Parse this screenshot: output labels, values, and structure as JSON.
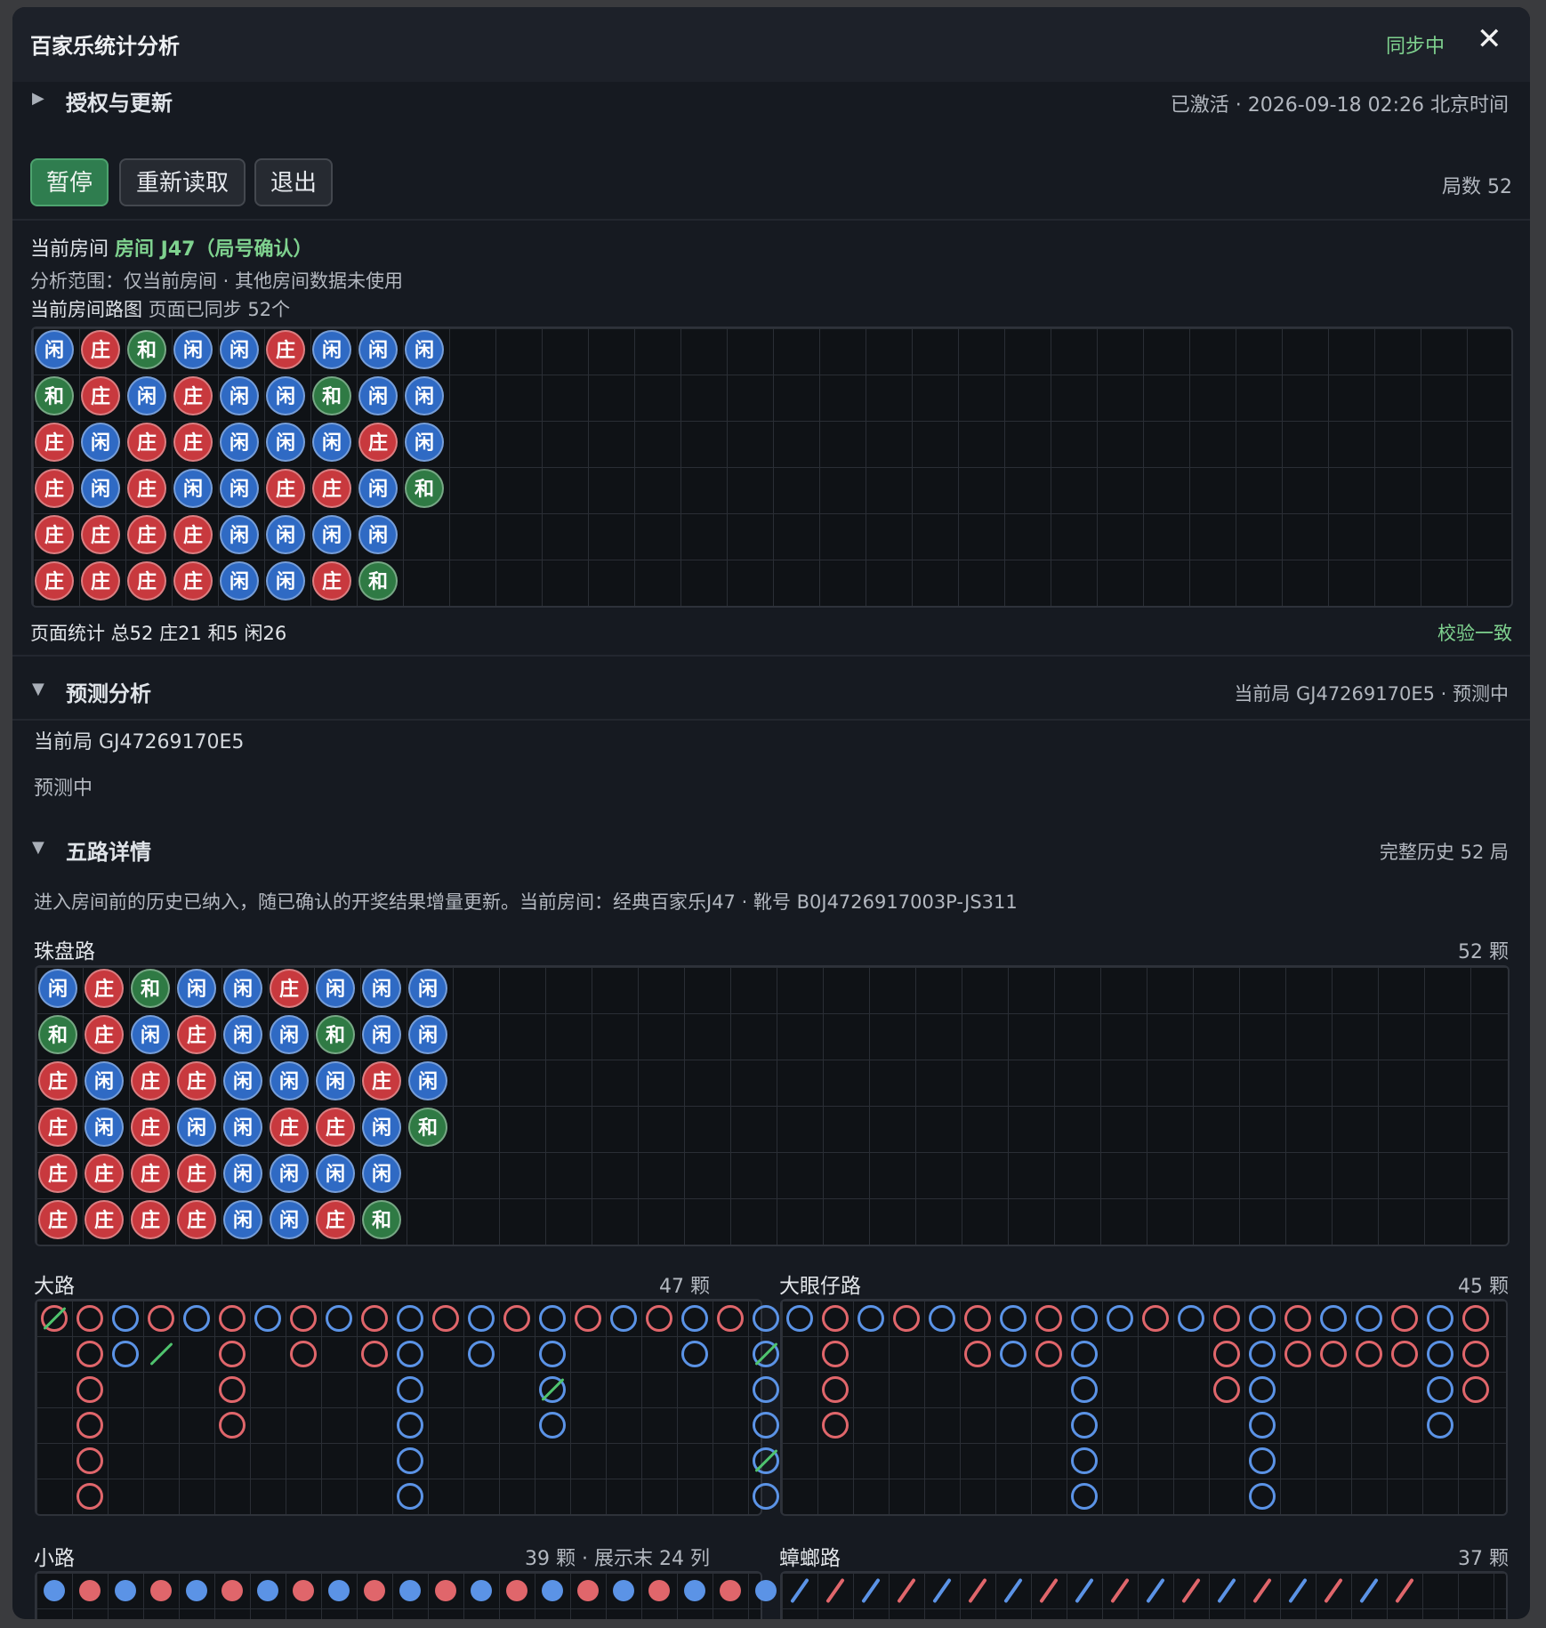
{
  "window": {
    "title": "百家乐统计分析",
    "sync_status": "同步中",
    "close_icon": "close-icon"
  },
  "auth": {
    "section_title": "授权与更新",
    "activation": "已激活 · 2026-09-18 02:26 北京时间",
    "buttons": {
      "pause": "暂停",
      "reload": "重新读取",
      "exit": "退出"
    },
    "round_count": "局数 52"
  },
  "room": {
    "label": "当前房间",
    "name": "房间 J47（局号确认）",
    "scope": "分析范围：仅当前房间 · 其他房间数据未使用",
    "roadmap_label": "当前房间路图",
    "roadmap_sync": "页面已同步 52个",
    "stats": "页面统计 总52 庄21 和5 闲26",
    "verify": "校验一致"
  },
  "prediction": {
    "section_title": "预测分析",
    "header_status": "当前局 GJ47269170E5 · 预测中",
    "current_round": "当前局 GJ47269170E5",
    "status": "预测中"
  },
  "five_roads": {
    "section_title": "五路详情",
    "history": "完整历史 52 局",
    "description": "进入房间前的历史已纳入，随已确认的开奖结果增量更新。当前房间：经典百家乐J47 · 靴号 B0J4726917003P-JS311",
    "bead_plate": {
      "label": "珠盘路",
      "count": "52 颗"
    },
    "big_road": {
      "label": "大路",
      "count": "47 颗"
    },
    "big_eye": {
      "label": "大眼仔路",
      "count": "45 颗"
    },
    "small_road": {
      "label": "小路",
      "count": "39 颗 · 展示末 24 列"
    },
    "cockroach": {
      "label": "蟑螂路",
      "count": "37 颗"
    }
  },
  "colors": {
    "banker": "#c8393e",
    "player": "#2f6ac4",
    "tie": "#2f7a44",
    "red_ring": "#e0666b",
    "blue_ring": "#5b93e6",
    "accent": "#7fd28f"
  },
  "bead_labels": {
    "B": "庄",
    "P": "闲",
    "T": "和"
  },
  "beads": [
    [
      "P",
      "T",
      "B",
      "B",
      "B",
      "B"
    ],
    [
      "B",
      "B",
      "P",
      "P",
      "B",
      "B"
    ],
    [
      "T",
      "P",
      "B",
      "B",
      "B",
      "B"
    ],
    [
      "P",
      "B",
      "B",
      "P",
      "B",
      "B"
    ],
    [
      "P",
      "P",
      "P",
      "P",
      "P",
      "P"
    ],
    [
      "B",
      "P",
      "P",
      "B",
      "P",
      "P"
    ],
    [
      "P",
      "T",
      "P",
      "B",
      "P",
      "B"
    ],
    [
      "P",
      "P",
      "B",
      "P",
      "P",
      "T"
    ],
    [
      "P",
      "P",
      "P",
      "T"
    ]
  ],
  "big_road_cols": [
    [
      "B"
    ],
    [
      "B",
      "B",
      "B",
      "B",
      "B",
      "B"
    ],
    [
      "P",
      "P"
    ],
    [
      "B"
    ],
    [
      "P"
    ],
    [
      "B",
      "B",
      "B",
      "B"
    ],
    [
      "P"
    ],
    [
      "B",
      "B"
    ],
    [
      "P"
    ],
    [
      "B",
      "B"
    ],
    [
      "P",
      "P",
      "P",
      "P",
      "P",
      "P"
    ],
    [
      "B"
    ],
    [
      "P",
      "P"
    ],
    [
      "B"
    ],
    [
      "P",
      "P",
      "P",
      "P"
    ],
    [
      "B"
    ],
    [
      "P"
    ],
    [
      "B"
    ],
    [
      "P",
      "P"
    ],
    [
      "B"
    ],
    [
      "P",
      "P",
      "P",
      "P",
      "P",
      "P"
    ]
  ],
  "big_road_ties": [
    [
      0,
      0
    ],
    [
      3,
      1
    ],
    [
      14,
      2
    ],
    [
      20,
      1
    ],
    [
      20,
      4
    ]
  ],
  "big_eye_cols": [
    [
      "P"
    ],
    [
      "B",
      "B",
      "B",
      "B"
    ],
    [
      "P"
    ],
    [
      "B"
    ],
    [
      "P"
    ],
    [
      "B",
      "B"
    ],
    [
      "P",
      "P"
    ],
    [
      "B",
      "B"
    ],
    [
      "P",
      "P",
      "P",
      "P",
      "P",
      "P"
    ],
    [
      "P"
    ],
    [
      "B"
    ],
    [
      "P"
    ],
    [
      "B",
      "B",
      "B"
    ],
    [
      "P",
      "P",
      "P",
      "P",
      "P",
      "P"
    ],
    [
      "B",
      "B"
    ],
    [
      "P",
      "B"
    ],
    [
      "P",
      "B"
    ],
    [
      "B",
      "B"
    ],
    [
      "P",
      "P",
      "P",
      "P"
    ],
    [
      "B",
      "B",
      "B"
    ]
  ],
  "small_road_top": [
    "P",
    "B",
    "P",
    "B",
    "P",
    "B",
    "P",
    "B",
    "P",
    "B",
    "P",
    "B",
    "P",
    "B",
    "P",
    "B",
    "P",
    "B",
    "P",
    "B",
    "P"
  ],
  "cockroach_top": [
    "P",
    "B",
    "P",
    "B",
    "P",
    "B",
    "P",
    "B",
    "P",
    "B",
    "P",
    "B",
    "P",
    "B",
    "P",
    "B",
    "P",
    "B"
  ]
}
